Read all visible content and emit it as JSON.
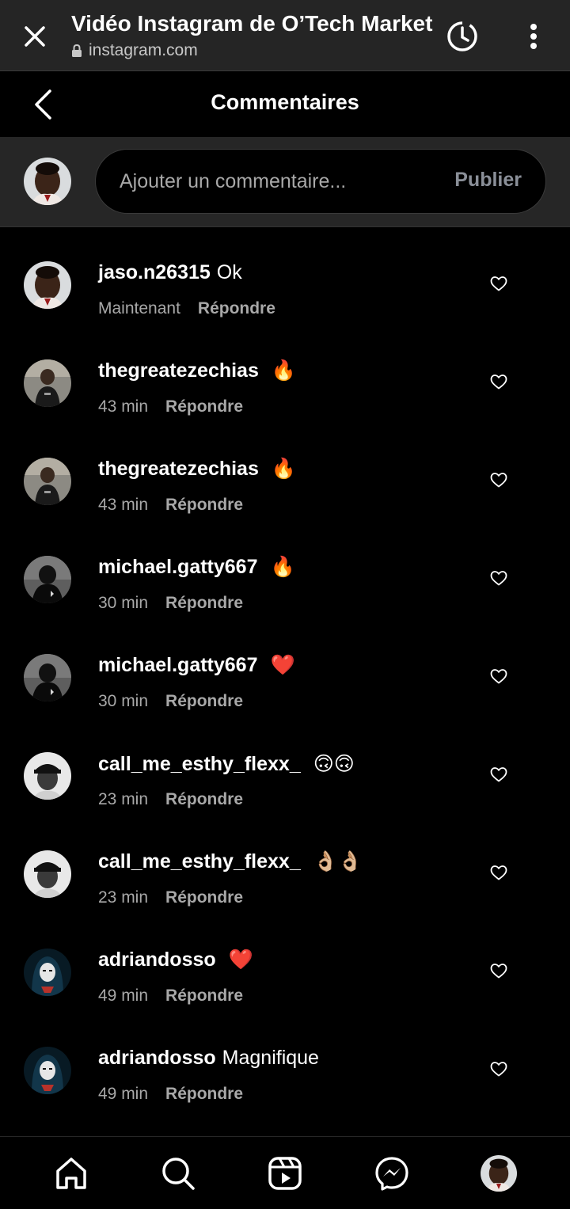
{
  "browser": {
    "title": "Vidéo Instagram de O’Tech Market",
    "url": "instagram.com"
  },
  "header": {
    "title": "Commentaires"
  },
  "composer": {
    "placeholder": "Ajouter un commentaire...",
    "publish_label": "Publier"
  },
  "comments": [
    {
      "user": "jaso.n26315",
      "text": "Ok",
      "emoji": "",
      "time": "Maintenant",
      "reply": "Répondre",
      "avatar": "avatar-a"
    },
    {
      "user": "thegreatezechias",
      "text": "",
      "emoji": "🔥",
      "time": "43 min",
      "reply": "Répondre",
      "avatar": "avatar-b"
    },
    {
      "user": "thegreatezechias",
      "text": "",
      "emoji": "🔥",
      "time": "43 min",
      "reply": "Répondre",
      "avatar": "avatar-b"
    },
    {
      "user": "michael.gatty667",
      "text": "",
      "emoji": "🔥",
      "time": "30 min",
      "reply": "Répondre",
      "avatar": "avatar-c"
    },
    {
      "user": "michael.gatty667",
      "text": "",
      "emoji": "❤️",
      "time": "30 min",
      "reply": "Répondre",
      "avatar": "avatar-c"
    },
    {
      "user": "call_me_esthy_flexx_",
      "text": "",
      "emoji": "🙃🙃",
      "time": "23 min",
      "reply": "Répondre",
      "avatar": "avatar-d"
    },
    {
      "user": "call_me_esthy_flexx_",
      "text": "",
      "emoji": "👌🏼👌🏼",
      "time": "23 min",
      "reply": "Répondre",
      "avatar": "avatar-d"
    },
    {
      "user": "adriandosso",
      "text": "",
      "emoji": "❤️",
      "time": "49 min",
      "reply": "Répondre",
      "avatar": "avatar-e"
    },
    {
      "user": "adriandosso",
      "text": "Magnifique",
      "emoji": "",
      "time": "49 min",
      "reply": "Répondre",
      "avatar": "avatar-e"
    }
  ],
  "nav": [
    "home-icon",
    "search-icon",
    "reels-icon",
    "messenger-icon",
    "profile-avatar"
  ],
  "colors": {
    "background": "#000000",
    "panel": "#262626",
    "muted": "#a8a8a8",
    "publish": "#8a8f98"
  }
}
